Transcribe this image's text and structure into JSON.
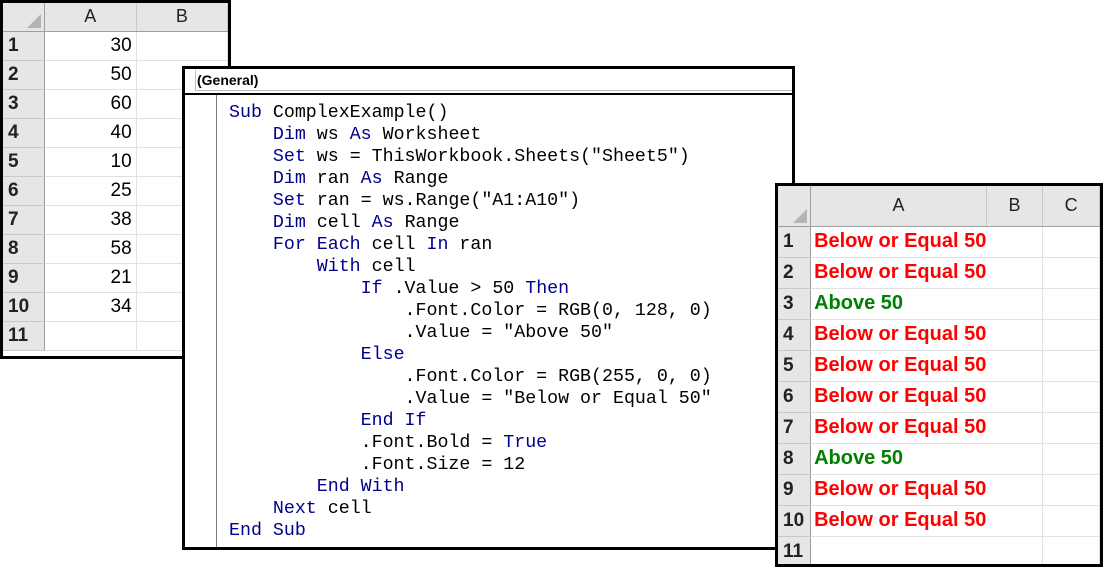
{
  "sheet1": {
    "columns": [
      "A",
      "B"
    ],
    "rows": [
      "1",
      "2",
      "3",
      "4",
      "5",
      "6",
      "7",
      "8",
      "9",
      "10",
      "11"
    ],
    "values": [
      "30",
      "50",
      "60",
      "40",
      "10",
      "25",
      "38",
      "58",
      "21",
      "34",
      ""
    ]
  },
  "editor": {
    "object_combo": "(General)",
    "code": [
      [
        {
          "t": "Sub ",
          "k": 1
        },
        {
          "t": "ComplexExample()",
          "k": 0
        }
      ],
      [
        {
          "t": "    ",
          "k": 0
        },
        {
          "t": "Dim",
          "k": 1
        },
        {
          "t": " ws ",
          "k": 0
        },
        {
          "t": "As",
          "k": 1
        },
        {
          "t": " Worksheet",
          "k": 0
        }
      ],
      [
        {
          "t": "    ",
          "k": 0
        },
        {
          "t": "Set",
          "k": 1
        },
        {
          "t": " ws = ThisWorkbook.Sheets(\"Sheet5\")",
          "k": 0
        }
      ],
      [
        {
          "t": "    ",
          "k": 0
        },
        {
          "t": "Dim",
          "k": 1
        },
        {
          "t": " ran ",
          "k": 0
        },
        {
          "t": "As",
          "k": 1
        },
        {
          "t": " Range",
          "k": 0
        }
      ],
      [
        {
          "t": "    ",
          "k": 0
        },
        {
          "t": "Set",
          "k": 1
        },
        {
          "t": " ran = ws.Range(\"A1:A10\")",
          "k": 0
        }
      ],
      [
        {
          "t": "    ",
          "k": 0
        },
        {
          "t": "Dim",
          "k": 1
        },
        {
          "t": " cell ",
          "k": 0
        },
        {
          "t": "As",
          "k": 1
        },
        {
          "t": " Range",
          "k": 0
        }
      ],
      [
        {
          "t": "    ",
          "k": 0
        },
        {
          "t": "For Each",
          "k": 1
        },
        {
          "t": " cell ",
          "k": 0
        },
        {
          "t": "In",
          "k": 1
        },
        {
          "t": " ran",
          "k": 0
        }
      ],
      [
        {
          "t": "        ",
          "k": 0
        },
        {
          "t": "With",
          "k": 1
        },
        {
          "t": " cell",
          "k": 0
        }
      ],
      [
        {
          "t": "            ",
          "k": 0
        },
        {
          "t": "If",
          "k": 1
        },
        {
          "t": " .Value > 50 ",
          "k": 0
        },
        {
          "t": "Then",
          "k": 1
        }
      ],
      [
        {
          "t": "                .Font.Color = RGB(0, 128, 0)",
          "k": 0
        }
      ],
      [
        {
          "t": "                .Value = \"Above 50\"",
          "k": 0
        }
      ],
      [
        {
          "t": "            ",
          "k": 0
        },
        {
          "t": "Else",
          "k": 1
        }
      ],
      [
        {
          "t": "                .Font.Color = RGB(255, 0, 0)",
          "k": 0
        }
      ],
      [
        {
          "t": "                .Value = \"Below or Equal 50\"",
          "k": 0
        }
      ],
      [
        {
          "t": "            ",
          "k": 0
        },
        {
          "t": "End If",
          "k": 1
        }
      ],
      [
        {
          "t": "            .Font.Bold = ",
          "k": 0
        },
        {
          "t": "True",
          "k": 1
        }
      ],
      [
        {
          "t": "            .Font.Size = 12",
          "k": 0
        }
      ],
      [
        {
          "t": "        ",
          "k": 0
        },
        {
          "t": "End With",
          "k": 1
        }
      ],
      [
        {
          "t": "    ",
          "k": 0
        },
        {
          "t": "Next",
          "k": 1
        },
        {
          "t": " cell",
          "k": 0
        }
      ],
      [
        {
          "t": "End Sub",
          "k": 1
        }
      ]
    ]
  },
  "sheet2": {
    "columns": [
      "A",
      "B",
      "C"
    ],
    "rows": [
      "1",
      "2",
      "3",
      "4",
      "5",
      "6",
      "7",
      "8",
      "9",
      "10",
      "11"
    ],
    "values": [
      "Below or Equal 50",
      "Below or Equal 50",
      "Above 50",
      "Below or Equal 50",
      "Below or Equal 50",
      "Below or Equal 50",
      "Below or Equal 50",
      "Above 50",
      "Below or Equal 50",
      "Below or Equal 50",
      ""
    ],
    "value_colors": [
      "red",
      "red",
      "green",
      "red",
      "red",
      "red",
      "red",
      "green",
      "red",
      "red",
      ""
    ]
  }
}
